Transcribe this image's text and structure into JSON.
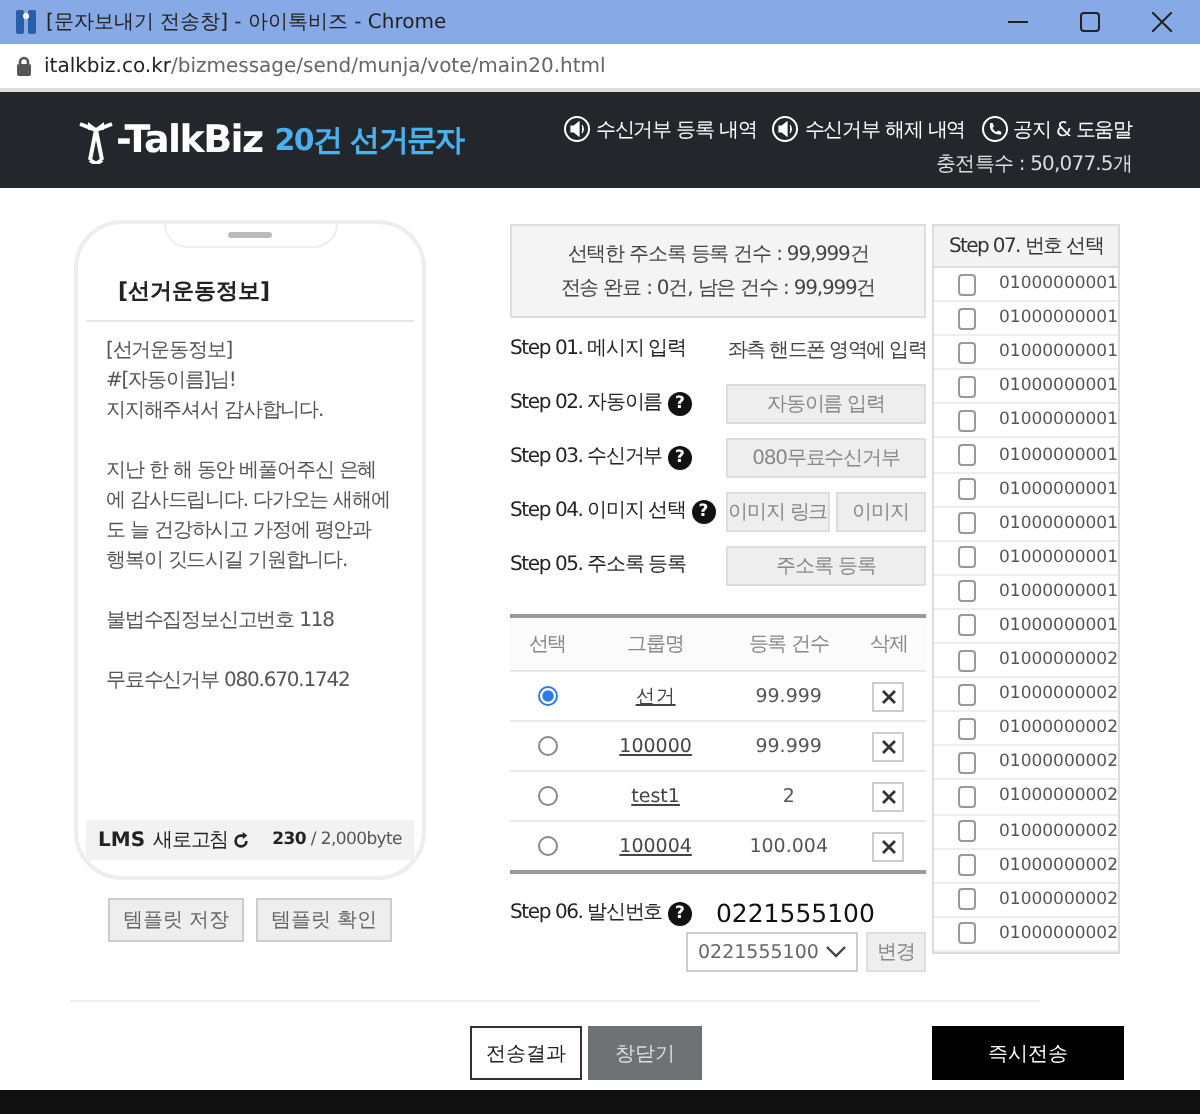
{
  "browser": {
    "title": "[문자보내기 전송창] - 아이톡비즈 - Chrome",
    "url_host": "italkbiz.co.kr",
    "url_path": "/bizmessage/send/munja/vote/main20.html"
  },
  "header": {
    "brand": "-TalkBiz",
    "product": "20건 선거문자",
    "links": [
      {
        "kind": "speaker",
        "label": "수신거부 등록 내역"
      },
      {
        "kind": "speaker",
        "label": "수신거부 해제 내역"
      },
      {
        "kind": "phone",
        "label": "공지 & 도움말"
      }
    ],
    "points": "충전특수 : 50,077.5개"
  },
  "phone": {
    "subject": "[선거운동정보]",
    "message": "[선거운동정보]\n#[자동이름]님!\n지지해주셔서 감사합니다.\n\n지난 한 해 동안 베풀어주신 은혜에 감사드립니다. 다가오는 새해에도 늘 건강하시고 가정에 평안과 행복이 깃드시길 기원합니다.\n\n불법수집정보신고번호 118\n\n무료수신거부 080.670.1742",
    "type": "LMS",
    "refresh": "새로고침",
    "bytes": "**230** / 2,000byte"
  },
  "template_buttons": [
    "템플릿 저장",
    "템플릿 확인"
  ],
  "summary": [
    "선택한 주소록 등록 건수 : 99,999건",
    "전송 완료 : 0건, 남은 건수 : 99,999건"
  ],
  "steps": [
    {
      "kind": "text",
      "label": "Step 01. 메시지 입력",
      "value": "좌측 핸드폰 영역에 입력"
    },
    {
      "kind": "buttons",
      "label": "Step 02. 자동이름",
      "help": "?",
      "buttons": [
        "자동이름 입력"
      ]
    },
    {
      "kind": "buttons",
      "label": "Step 03. 수신거부",
      "help": "?",
      "buttons": [
        "080무료수신거부"
      ]
    },
    {
      "kind": "buttons",
      "label": "Step 04. 이미지 선택",
      "help": "?",
      "buttons": [
        "이미지 링크",
        "이미지"
      ]
    },
    {
      "kind": "buttons",
      "label": "Step 05. 주소록 등록",
      "buttons": [
        "주소록 등록"
      ]
    }
  ],
  "address_table": {
    "columns": [
      "선택",
      "그룹명",
      "등록 건수",
      "삭제"
    ],
    "rows": [
      {
        "selected": true,
        "group": "선거",
        "count": "99.999"
      },
      {
        "selected": false,
        "group": "100000",
        "count": "99.999"
      },
      {
        "selected": false,
        "group": "test1",
        "count": "2"
      },
      {
        "selected": false,
        "group": "100004",
        "count": "100.004"
      }
    ]
  },
  "sender": {
    "label": "Step 06. 발신번호",
    "help": "?",
    "number": "0221555100",
    "select_value": "0221555100",
    "change_button": "변경"
  },
  "numbers": {
    "title": "Step 07. 번호 선택",
    "items": [
      {
        "number": "01000000001",
        "checked": false
      },
      {
        "number": "01000000001",
        "checked": false
      },
      {
        "number": "01000000001",
        "checked": false
      },
      {
        "number": "01000000001",
        "checked": false
      },
      {
        "number": "01000000001",
        "checked": false
      },
      {
        "number": "01000000001",
        "checked": false
      },
      {
        "number": "01000000001",
        "checked": false
      },
      {
        "number": "01000000001",
        "checked": false
      },
      {
        "number": "01000000001",
        "checked": false
      },
      {
        "number": "01000000001",
        "checked": false
      },
      {
        "number": "01000000001",
        "checked": false
      },
      {
        "number": "01000000002",
        "checked": false
      },
      {
        "number": "01000000002",
        "checked": false
      },
      {
        "number": "01000000002",
        "checked": false
      },
      {
        "number": "01000000002",
        "checked": false
      },
      {
        "number": "01000000002",
        "checked": false
      },
      {
        "number": "01000000002",
        "checked": false
      },
      {
        "number": "01000000002",
        "checked": false
      },
      {
        "number": "01000000002",
        "checked": false
      },
      {
        "number": "01000000002",
        "checked": false
      }
    ]
  },
  "footer_buttons": [
    {
      "kind": "outline",
      "label": "전송결과"
    },
    {
      "kind": "gray",
      "label": "창닫기"
    },
    {
      "kind": "black",
      "label": "즉시전송"
    }
  ]
}
